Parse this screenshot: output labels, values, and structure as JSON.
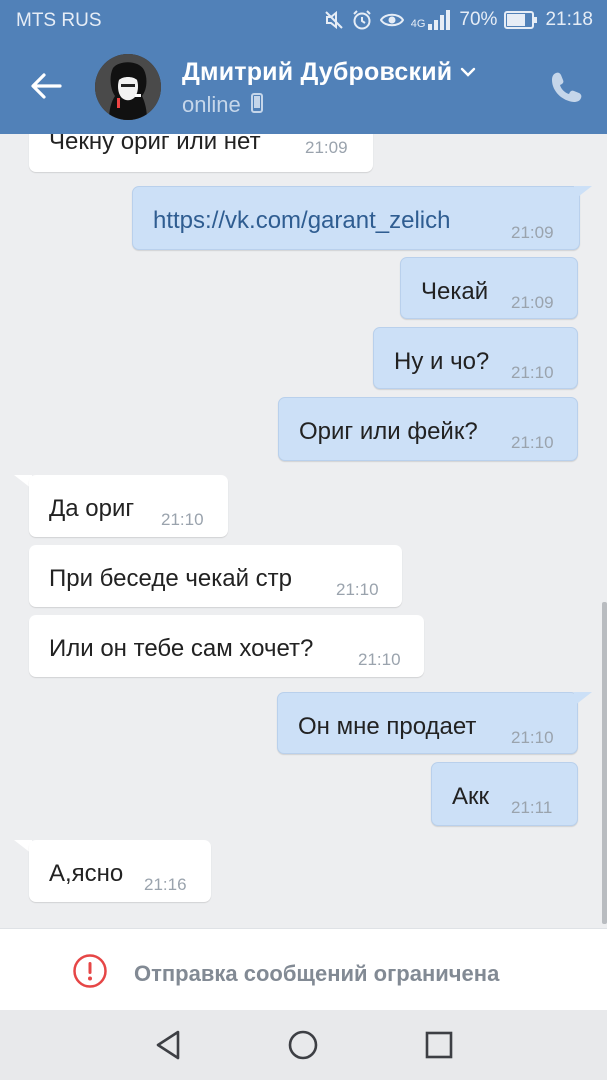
{
  "status_bar": {
    "carrier": "MTS RUS",
    "network": "4G",
    "battery": "70%",
    "clock": "21:18",
    "icons": [
      "mute-icon",
      "alarm-icon",
      "eye-icon",
      "signal-icon",
      "battery-icon"
    ]
  },
  "header": {
    "contact_name": "Дмитрий Дубровский",
    "presence": "online",
    "icons": [
      "back-arrow-icon",
      "chevron-down-icon",
      "mobile-icon",
      "phone-icon"
    ]
  },
  "messages": [
    {
      "dir": "in",
      "text": "Чекну ориг или нет",
      "time": "21:09"
    },
    {
      "dir": "out",
      "text": "https://vk.com/garant_zelich",
      "time": "21:09",
      "is_link": true
    },
    {
      "dir": "out",
      "text": "Чекай",
      "time": "21:09"
    },
    {
      "dir": "out",
      "text": "Ну и чо?",
      "time": "21:10"
    },
    {
      "dir": "out",
      "text": "Ориг или фейк?",
      "time": "21:10"
    },
    {
      "dir": "in",
      "text": "Да ориг",
      "time": "21:10"
    },
    {
      "dir": "in",
      "text": "При беседе чекай стр",
      "time": "21:10"
    },
    {
      "dir": "in",
      "text": "Или он тебе сам хочет?",
      "time": "21:10"
    },
    {
      "dir": "out",
      "text": "Он мне продает",
      "time": "21:10"
    },
    {
      "dir": "out",
      "text": "Акк",
      "time": "21:11"
    },
    {
      "dir": "in",
      "text": "А,ясно",
      "time": "21:16"
    }
  ],
  "restriction": {
    "text": "Отправка сообщений ограничена",
    "icon": "alert-circle-icon",
    "color": "#e64646"
  },
  "nav": {
    "icons": [
      "nav-back-icon",
      "nav-home-icon",
      "nav-recents-icon"
    ]
  },
  "colors": {
    "header": "#5181b8",
    "incoming_bubble": "#ffffff",
    "outgoing_bubble": "#cce0f7",
    "background": "#edeef0"
  }
}
